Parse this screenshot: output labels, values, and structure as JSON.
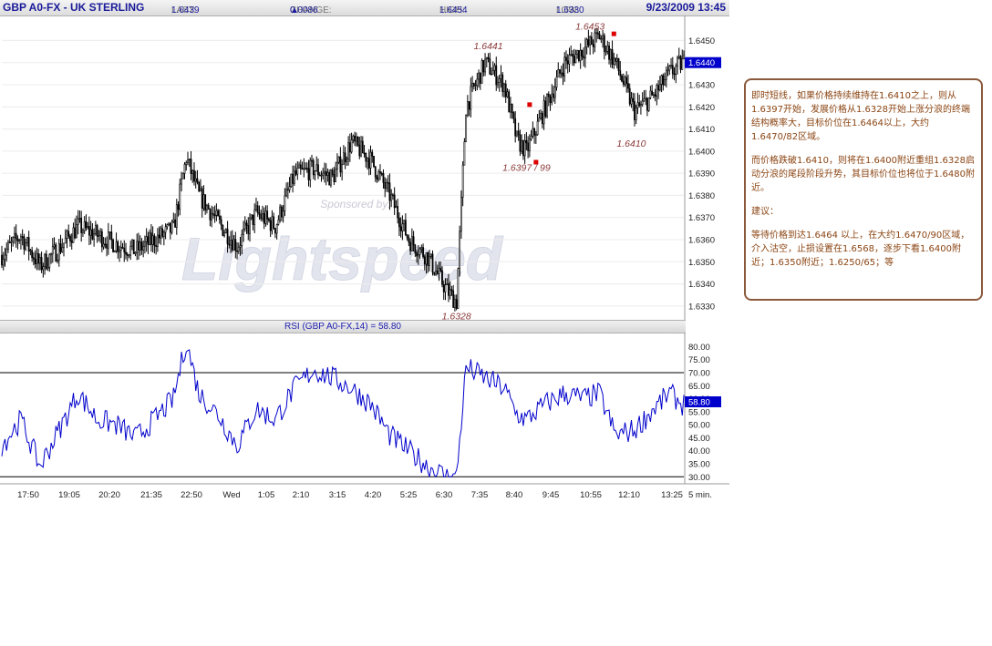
{
  "header": {
    "symbol": "GBP A0-FX - UK STERLING",
    "last_label": "LAST:",
    "last_value": "1.6439",
    "change_label": "CHANGE:",
    "change_arrow": "▲",
    "change_value": "0.0086",
    "high_label": "HIGH:",
    "high_value": "1.6454",
    "low_label": "LOW:",
    "low_value": "1.6330",
    "date_time": "9/23/2009 13:45"
  },
  "colors": {
    "candles": "#000000",
    "rsi_line": "#0000cc",
    "annotation": "#8b3a3a",
    "marker": "#dd0000",
    "price_tag_bg": "#0000cc",
    "note_text": "#8b4513"
  },
  "watermark": {
    "brand": "Lightspeed",
    "sponsored": "Sponsored by:"
  },
  "chart_data": [
    {
      "type": "candlestick",
      "ylim": [
        1.6325,
        1.6458
      ],
      "y_ticks": [
        "1.6330",
        "1.6340",
        "1.6350",
        "1.6360",
        "1.6370",
        "1.6380",
        "1.6390",
        "1.6400",
        "1.6410",
        "1.6420",
        "1.6430",
        "1.6440",
        "1.6450"
      ],
      "current_price_tag": "1.6440",
      "x_ticks": [
        "17:50",
        "19:05",
        "20:20",
        "21:35",
        "22:50",
        "Wed",
        "1:05",
        "2:10",
        "3:15",
        "4:20",
        "5:25",
        "6:30",
        "7:35",
        "8:40",
        "9:45",
        "10:55",
        "12:10",
        "13:25"
      ],
      "interval_label": "5 min.",
      "close_path": [
        [
          0,
          1.6353
        ],
        [
          12,
          1.6362
        ],
        [
          24,
          1.6348
        ],
        [
          36,
          1.6356
        ],
        [
          48,
          1.6366
        ],
        [
          60,
          1.6362
        ],
        [
          72,
          1.6358
        ],
        [
          84,
          1.6355
        ],
        [
          96,
          1.636
        ],
        [
          108,
          1.6365
        ],
        [
          116,
          1.6397
        ],
        [
          124,
          1.638
        ],
        [
          136,
          1.6368
        ],
        [
          148,
          1.6357
        ],
        [
          160,
          1.6372
        ],
        [
          172,
          1.6366
        ],
        [
          184,
          1.6389
        ],
        [
          196,
          1.6392
        ],
        [
          208,
          1.6388
        ],
        [
          220,
          1.6404
        ],
        [
          232,
          1.6396
        ],
        [
          244,
          1.638
        ],
        [
          256,
          1.636
        ],
        [
          268,
          1.6352
        ],
        [
          280,
          1.6337
        ],
        [
          286,
          1.6332
        ],
        [
          292,
          1.642
        ],
        [
          304,
          1.644
        ],
        [
          316,
          1.643
        ],
        [
          324,
          1.6405
        ],
        [
          330,
          1.64
        ],
        [
          342,
          1.642
        ],
        [
          354,
          1.644
        ],
        [
          366,
          1.6446
        ],
        [
          376,
          1.6452
        ],
        [
          386,
          1.644
        ],
        [
          398,
          1.6418
        ],
        [
          410,
          1.6425
        ],
        [
          420,
          1.6435
        ],
        [
          428,
          1.644
        ]
      ],
      "annotations": [
        {
          "text": "1.6441",
          "at": [
            306,
            1.6446
          ]
        },
        {
          "text": "1.6453",
          "at": [
            370,
            1.6455
          ]
        },
        {
          "text": "1.6397 / 99",
          "at": [
            330,
            1.6391
          ]
        },
        {
          "text": "1.6410",
          "at": [
            396,
            1.6402
          ]
        },
        {
          "text": "1.6328",
          "at": [
            286,
            1.6324
          ]
        }
      ],
      "markers": [
        [
          385,
          1.6453
        ],
        [
          332,
          1.6421
        ],
        [
          336,
          1.6395
        ]
      ]
    },
    {
      "type": "line",
      "name": "RSI (GBP A0-FX,14) = 58.80",
      "ylim": [
        28,
        84
      ],
      "y_ticks": [
        "30.00",
        "35.00",
        "40.00",
        "45.00",
        "50.00",
        "55.00",
        "60.00",
        "65.00",
        "70.00",
        "75.00",
        "80.00"
      ],
      "reference_lines": [
        70,
        30
      ],
      "current_value_tag": "58.80",
      "values_path": [
        [
          0,
          42
        ],
        [
          12,
          52
        ],
        [
          24,
          34
        ],
        [
          36,
          48
        ],
        [
          48,
          62
        ],
        [
          60,
          52
        ],
        [
          72,
          50
        ],
        [
          84,
          45
        ],
        [
          96,
          52
        ],
        [
          108,
          60
        ],
        [
          116,
          82
        ],
        [
          124,
          62
        ],
        [
          136,
          54
        ],
        [
          148,
          42
        ],
        [
          160,
          56
        ],
        [
          172,
          52
        ],
        [
          184,
          64
        ],
        [
          196,
          71
        ],
        [
          208,
          68
        ],
        [
          220,
          64
        ],
        [
          232,
          58
        ],
        [
          244,
          46
        ],
        [
          256,
          40
        ],
        [
          268,
          34
        ],
        [
          280,
          30
        ],
        [
          286,
          30
        ],
        [
          292,
          72
        ],
        [
          304,
          68
        ],
        [
          316,
          64
        ],
        [
          324,
          54
        ],
        [
          330,
          52
        ],
        [
          342,
          58
        ],
        [
          354,
          62
        ],
        [
          366,
          60
        ],
        [
          376,
          62
        ],
        [
          386,
          46
        ],
        [
          398,
          48
        ],
        [
          410,
          56
        ],
        [
          420,
          62
        ],
        [
          428,
          58
        ]
      ]
    }
  ],
  "notes": {
    "para1": "即时短线，如果价格持续维持在1.6410之上，则从1.6397开始，发展价格从1.6328开始上涨分浪的终端结构概率大，目标价位在1.6464以上，大约1.6470/82区域。",
    "para2": "而价格跌破1.6410，则将在1.6400附近重组1.6328启动分浪的尾段阶段升势，其目标价位也将位于1.6480附近。",
    "para3": "建议：",
    "para4": "等待价格到达1.6464 以上，在大约1.6470/90区域，介入沽空，止损设置在1.6568，逐步下看1.6400附近；1.6350附近；1.6250/65；等"
  }
}
